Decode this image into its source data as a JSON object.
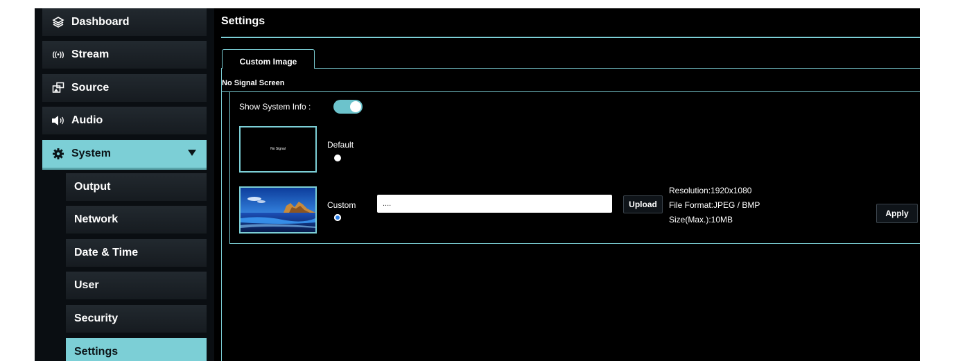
{
  "sidebar": {
    "items": [
      {
        "label": "Dashboard",
        "icon": "layers-icon"
      },
      {
        "label": "Stream",
        "icon": "broadcast-icon"
      },
      {
        "label": "Source",
        "icon": "source-icon"
      },
      {
        "label": "Audio",
        "icon": "speaker-icon"
      },
      {
        "label": "System",
        "icon": "gear-icon",
        "expanded": true
      }
    ],
    "subitems": [
      {
        "label": "Output"
      },
      {
        "label": "Network"
      },
      {
        "label": "Date & Time"
      },
      {
        "label": "User"
      },
      {
        "label": "Security"
      },
      {
        "label": "Settings",
        "active": true
      }
    ]
  },
  "main": {
    "title": "Settings",
    "tab": "Custom Image",
    "section": "No Signal Screen",
    "show_system_info_label": "Show System Info :",
    "show_system_info": true,
    "default_preview_text": "No Signal",
    "default_label": "Default",
    "custom_label": "Custom",
    "selected_option": "Custom",
    "file_value": "....",
    "upload_label": "Upload",
    "apply_label": "Apply",
    "info": {
      "resolution": "Resolution:1920x1080",
      "format": "File Format:JPEG / BMP",
      "size": "Size(Max.):10MB"
    }
  },
  "colors": {
    "accent": "#7ccfd6",
    "background": "#000000",
    "radio_selected": "#2a7ee6"
  }
}
